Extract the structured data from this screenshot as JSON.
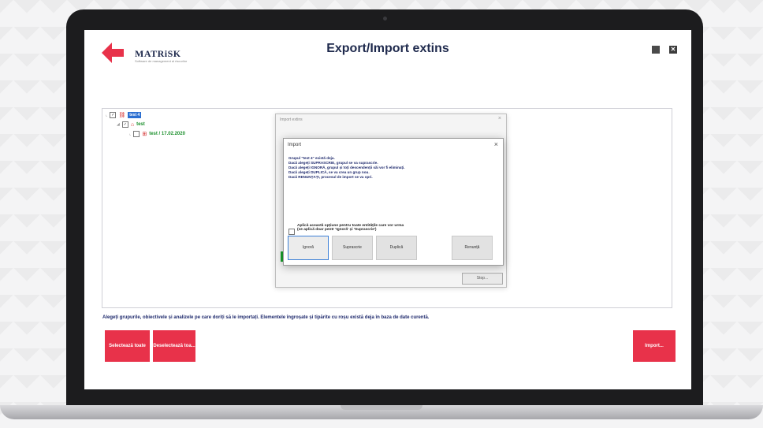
{
  "app": {
    "logo": "MATRiSK",
    "logo_sub": "Software de management al riscurilor",
    "title": "Export/Import extins"
  },
  "window": {
    "close_label": "✕"
  },
  "tree": {
    "root_label": "test 4",
    "child_label": "test",
    "leaf_label": "test / 17.02.2020"
  },
  "outer_dialog": {
    "title": "Import extins",
    "close": "×",
    "stop_button": "Stop..."
  },
  "inner_dialog": {
    "title": "Import",
    "close": "×",
    "messages": [
      "Grupul \"test 4\" există deja.",
      "Dacă alegeți SUPRASCRIE, grupul se va suprascrie.",
      "Dacă alegeți IGNORĂ, grupul și toți descendenții săi vor fi eliminați.",
      "Dacă alegeți DUPLICĂ, se va crea un grup nou.",
      "Dacă RENUNȚAȚI, procesul de import se va opri."
    ],
    "apply_all_line1": "Aplică această opțiune pentru toate entitățile care vor urma",
    "apply_all_line2": "(se aplică doar pentr 'Ignoră' și 'Suprascrie')",
    "buttons": {
      "ignore": "Ignoră",
      "overwrite": "Suprascrie",
      "duplicate": "Duplică",
      "cancel": "Renunță"
    }
  },
  "footer": {
    "help_text": "Alegeți grupurile, obiectivele și analizele pe care doriți să le importați. Elementele îngroșate și tipărite cu roșu există deja în baza de date curentă.",
    "select_all": "Selectează toate",
    "deselect_all": "Deselectează toa...",
    "import": "Import..."
  },
  "colors": {
    "accent_red": "#e8324a",
    "title_navy": "#1f2a4d",
    "selection_blue": "#2c6fd1",
    "status_green": "#1aa32e"
  }
}
